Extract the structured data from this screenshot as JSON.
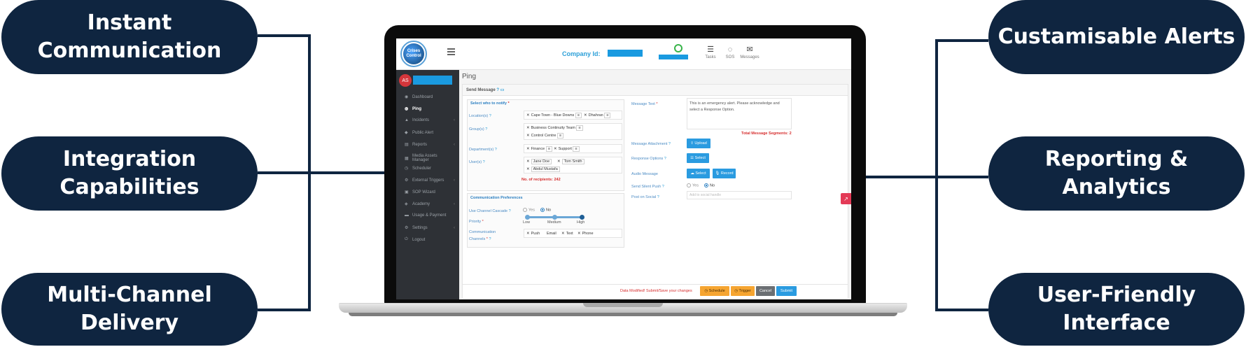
{
  "features_left": [
    {
      "line1": "Instant",
      "line2": "Communication"
    },
    {
      "line1": "Integration Capabilities"
    },
    {
      "line1": "Multi-Channel Delivery"
    }
  ],
  "features_right": [
    {
      "line1": "Custamisable Alerts"
    },
    {
      "line1": "Reporting & Analytics"
    },
    {
      "line1": "User-Friendly Interface"
    }
  ],
  "colors": {
    "pill": "#0f2540",
    "accent": "#2a9be0",
    "sidebar": "#2e3136",
    "danger": "#d62d2d"
  },
  "app": {
    "logo_text": [
      "Crises",
      "Control"
    ],
    "company_label": "Company Id:",
    "header_icons": [
      {
        "icon": "tasks-icon",
        "label": "Tasks"
      },
      {
        "icon": "sos-icon",
        "label": "SOS"
      },
      {
        "icon": "messages-icon",
        "label": "Messages"
      }
    ],
    "user_initials": "AS",
    "sidebar": [
      {
        "label": "Dashboard",
        "icon": "dashboard-icon",
        "arrow": false,
        "active": false
      },
      {
        "label": "Ping",
        "icon": "ping-icon",
        "arrow": false,
        "active": true
      },
      {
        "label": "Incidents",
        "icon": "incidents-icon",
        "arrow": true,
        "active": false
      },
      {
        "label": "Public Alert",
        "icon": "public-alert-icon",
        "arrow": false,
        "active": false
      },
      {
        "label": "Reports",
        "icon": "reports-icon",
        "arrow": true,
        "active": false
      },
      {
        "label": "Media Assets Manager",
        "icon": "media-icon",
        "arrow": false,
        "active": false
      },
      {
        "label": "Scheduler",
        "icon": "scheduler-icon",
        "arrow": false,
        "active": false
      },
      {
        "label": "External Triggers",
        "icon": "triggers-icon",
        "arrow": true,
        "active": false
      },
      {
        "label": "SOP Wizard",
        "icon": "sop-icon",
        "arrow": false,
        "active": false
      },
      {
        "label": "Academy",
        "icon": "academy-icon",
        "arrow": true,
        "active": false
      },
      {
        "label": "Usage & Payment",
        "icon": "payment-icon",
        "arrow": false,
        "active": false
      },
      {
        "label": "Settings",
        "icon": "settings-icon",
        "arrow": true,
        "active": false
      },
      {
        "label": "Logout",
        "icon": "logout-icon",
        "arrow": false,
        "active": false
      }
    ],
    "page_title": "Ping",
    "panel_title": "Send Message",
    "notify": {
      "title": "Select who to notify",
      "locations_label": "Location(s)",
      "locations": [
        "Cape Town - Blue Downs",
        "Dhahran"
      ],
      "groups_label": "Group(s)",
      "groups": [
        "Business Continuity Team",
        "Control Centre"
      ],
      "departments_label": "Department(s)",
      "departments": [
        "Finance",
        "Support"
      ],
      "users_label": "User(s)",
      "users": [
        "Jane Doe",
        "Tom Smith",
        "Abdul Mustafa"
      ],
      "recipients_label": "No. of recipients:",
      "recipients_count": "242"
    },
    "prefs": {
      "title": "Communication Preferences",
      "cascade_label": "Use Channel Cascade",
      "yes": "Yes",
      "no": "No",
      "priority_label": "Priority",
      "priority_levels": [
        "Low",
        "Medium",
        "High"
      ],
      "priority_value": "High",
      "channels_label_1": "Communication",
      "channels_label_2": "Channels",
      "channels": [
        "Push",
        "Email",
        "Text",
        "Phone"
      ]
    },
    "message": {
      "text_label": "Message Text",
      "text": "This is an emergency alert. Please acknowledge and select a Response Option.",
      "segments": "Total Message Segments: 2",
      "attachment_label": "Message Attachment",
      "upload": "Upload",
      "response_label": "Response Options",
      "select": "Select",
      "audio_label": "Audio Message",
      "record": "Record",
      "silent_label": "Send Silent Push",
      "silent_value": "No",
      "social_label": "Post on Social",
      "social_placeholder": "Add to social handle"
    },
    "footer": {
      "modified": "Data Modified! Submit/Save your changes",
      "schedule": "Schedule",
      "trigger": "Trigger",
      "cancel": "Cancel",
      "submit": "Submit"
    }
  }
}
